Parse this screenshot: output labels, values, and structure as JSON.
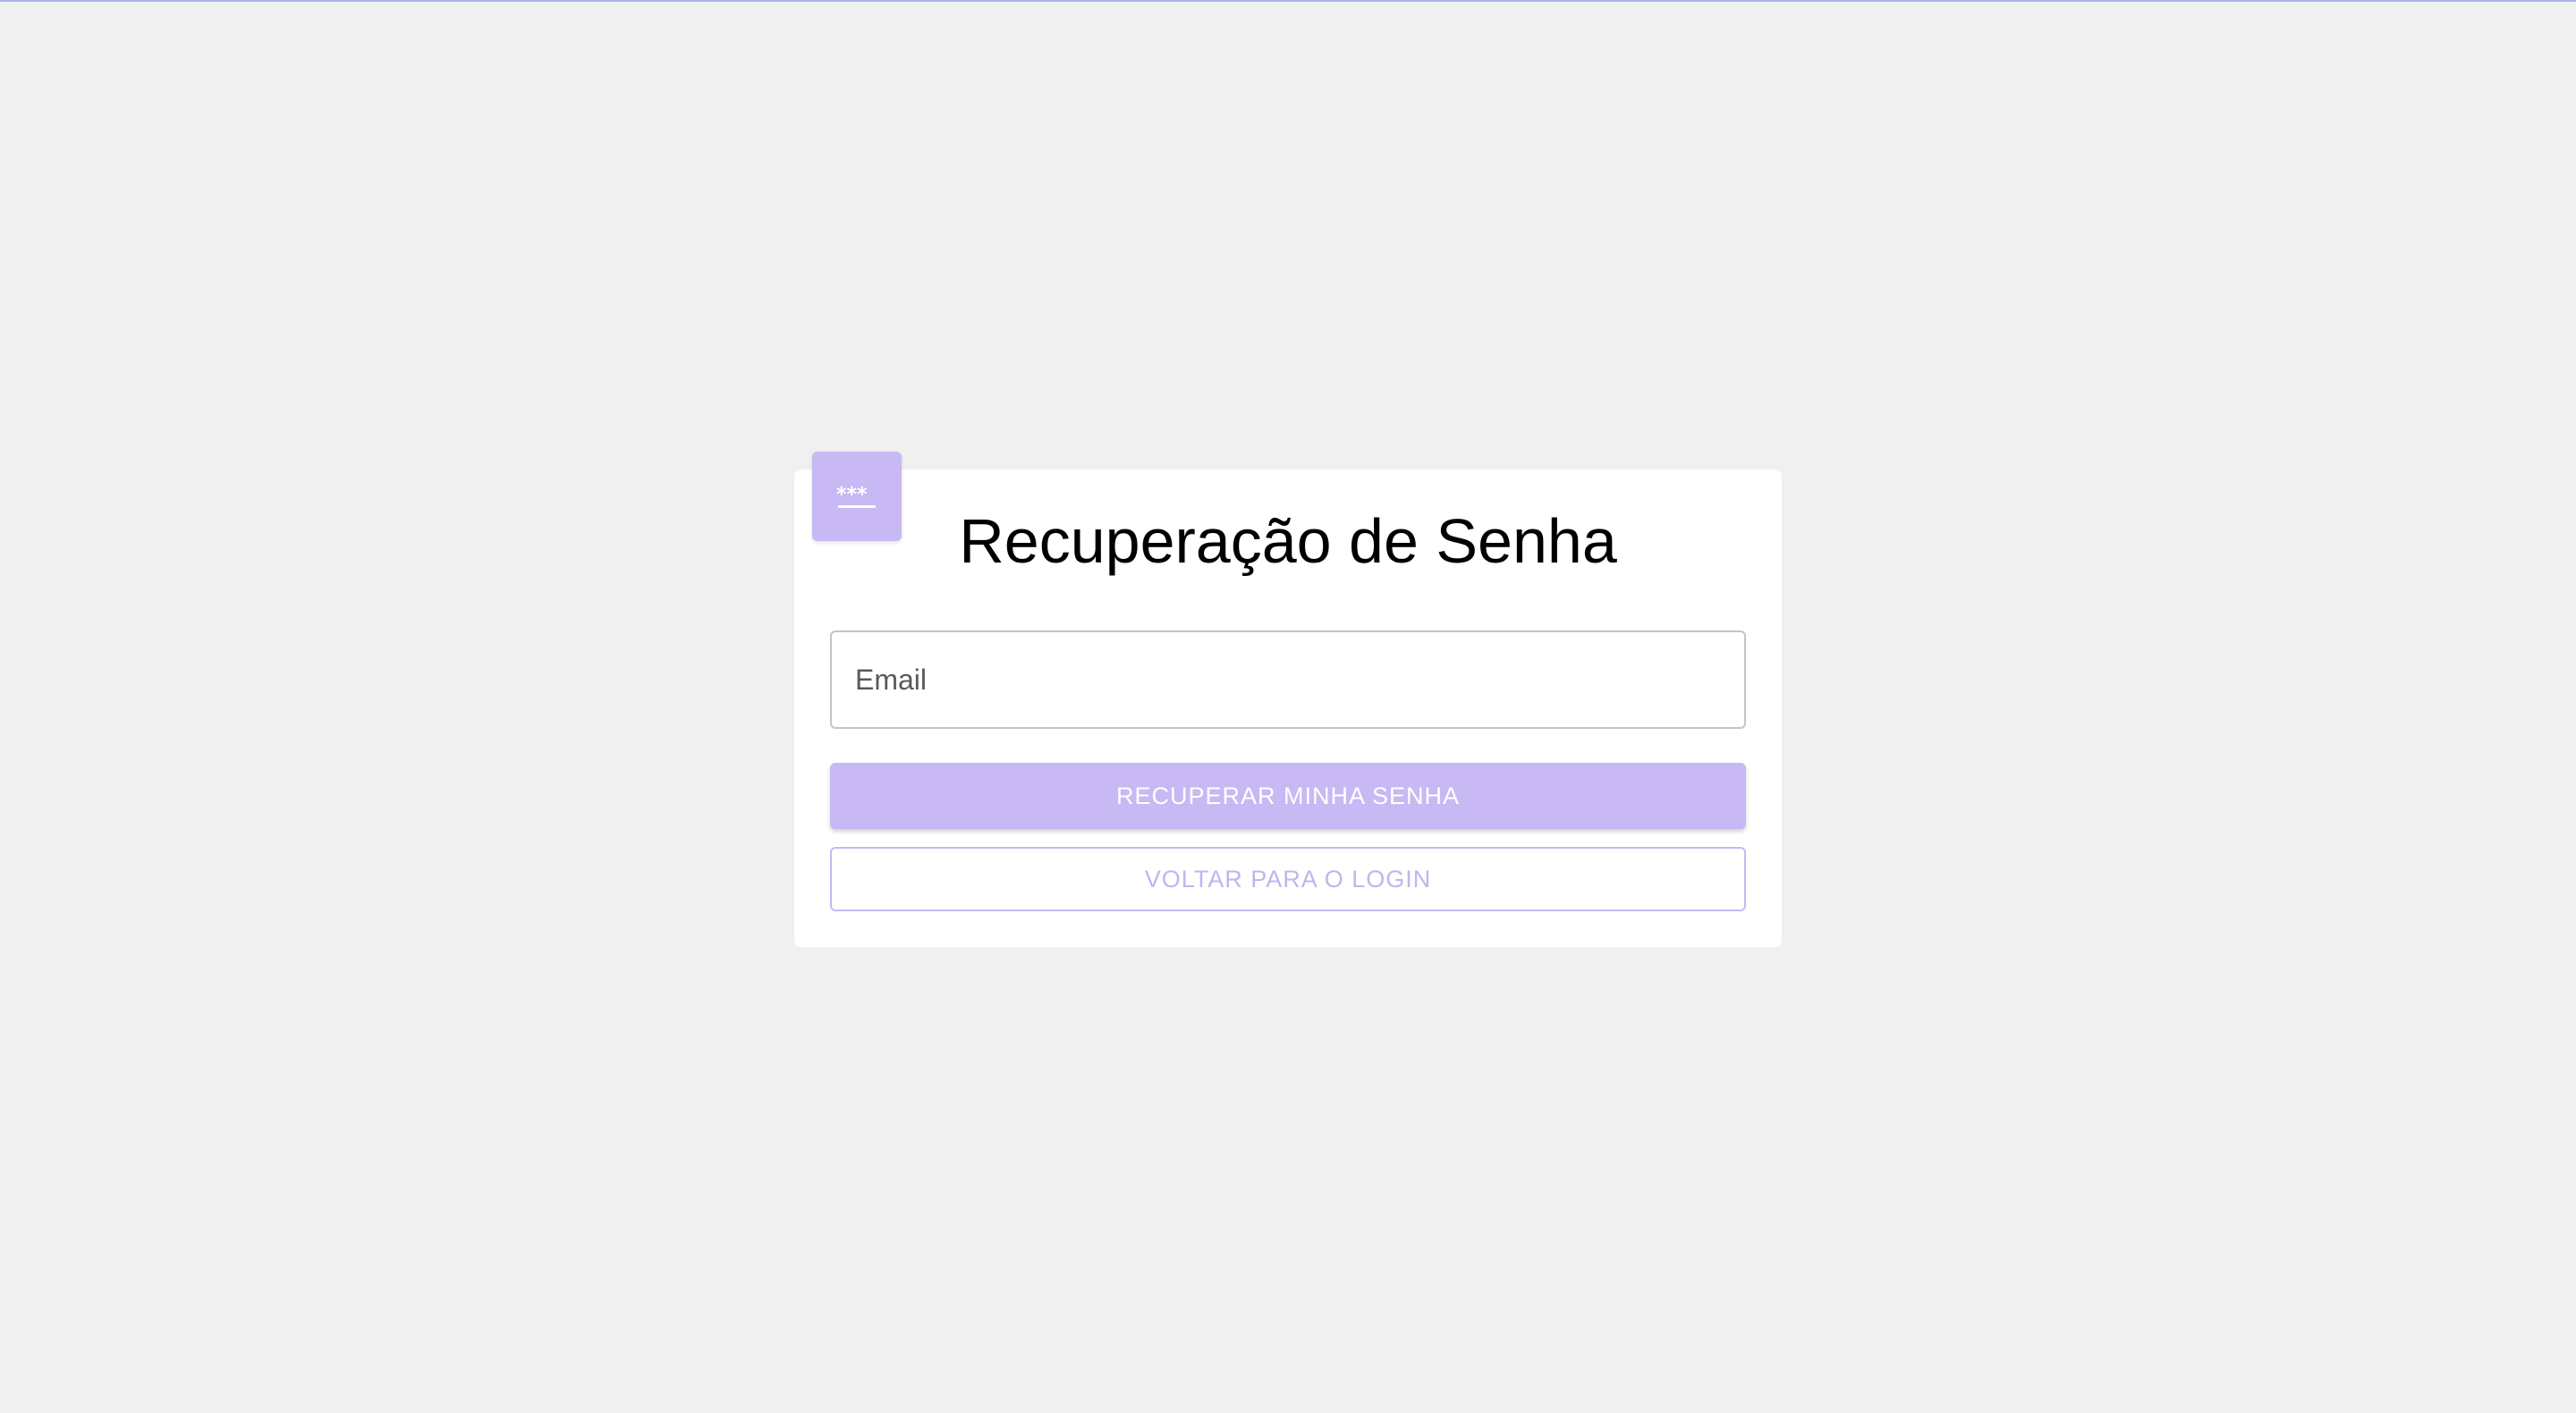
{
  "page": {
    "background_color": "#f0f0f0",
    "top_line_color": "#aab3e8"
  },
  "card": {
    "badge_icon": "password-icon",
    "badge_color": "#c8b8f3",
    "title": "Recuperação de Senha"
  },
  "form": {
    "email": {
      "value": "",
      "placeholder": "Email"
    },
    "recover_label": "RECUPERAR MINHA SENHA",
    "back_label": "VOLTAR PARA O LOGIN",
    "accent_color": "#c8b8f3"
  }
}
